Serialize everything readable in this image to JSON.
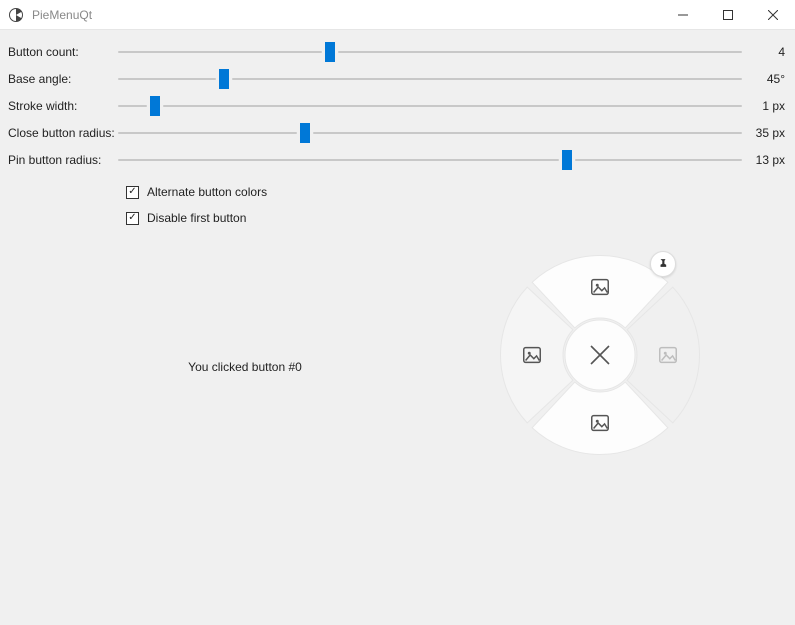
{
  "window": {
    "title": "PieMenuQt"
  },
  "sliders": [
    {
      "label": "Button count:",
      "value_text": "4",
      "percent": 34.0
    },
    {
      "label": "Base angle:",
      "value_text": "45°",
      "percent": 17.0
    },
    {
      "label": "Stroke width:",
      "value_text": "1 px",
      "percent": 6.0
    },
    {
      "label": "Close button radius:",
      "value_text": "35 px",
      "percent": 30.0
    },
    {
      "label": "Pin button radius:",
      "value_text": "13 px",
      "percent": 72.0
    }
  ],
  "checks": [
    {
      "label": "Alternate button colors",
      "checked": true
    },
    {
      "label": "Disable first button",
      "checked": true
    }
  ],
  "status_text": "You clicked button #0",
  "pie": {
    "button_count": 4,
    "base_angle_deg": 45,
    "outer_radius": 100,
    "stroke_px": 1,
    "close_radius": 35,
    "pin_radius": 13,
    "disabled_first": true,
    "alternate_colors": true
  }
}
